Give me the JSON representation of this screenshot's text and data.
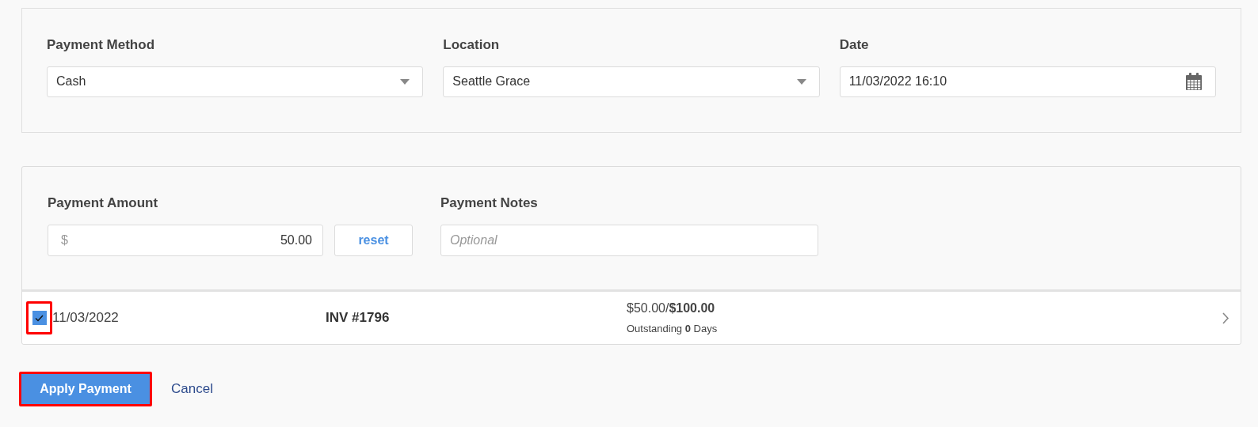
{
  "filters": [
    {
      "label": "Payment Method",
      "value": "Cash",
      "kind": "select"
    },
    {
      "label": "Location",
      "value": "Seattle Grace",
      "kind": "select"
    },
    {
      "label": "Date",
      "value": "11/03/2022 16:10",
      "kind": "date"
    }
  ],
  "payment": {
    "amount_label": "Payment Amount",
    "currency": "$",
    "amount": "50.00",
    "reset": "reset",
    "notes_label": "Payment Notes",
    "notes_placeholder": "Optional"
  },
  "invoices": [
    {
      "checked": true,
      "highlighted": true,
      "date": "11/03/2022",
      "number": "INV #1796",
      "amounts": "$50.00/**$100.00**",
      "outstanding": "Outstanding **0** Days"
    }
  ],
  "actions": {
    "apply": {
      "label": "Apply Payment",
      "highlighted": true
    },
    "cancel": "Cancel"
  }
}
